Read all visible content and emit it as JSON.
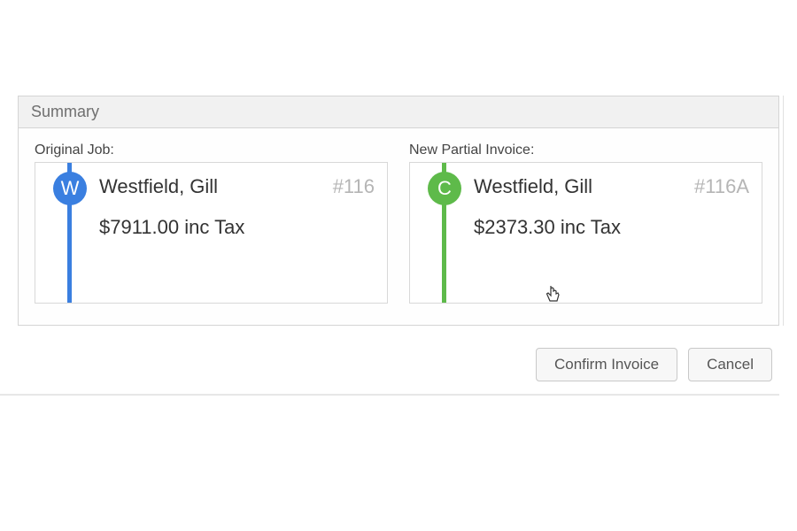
{
  "summary": {
    "header": "Summary",
    "original": {
      "label": "Original Job:",
      "badge": "W",
      "name": "Westfield, Gill",
      "ref": "#116",
      "amount": "$7911.00 inc Tax"
    },
    "partial": {
      "label": "New Partial Invoice:",
      "badge": "C",
      "name": "Westfield, Gill",
      "ref": "#116A",
      "amount": "$2373.30 inc Tax"
    }
  },
  "buttons": {
    "confirm": "Confirm Invoice",
    "cancel": "Cancel"
  }
}
